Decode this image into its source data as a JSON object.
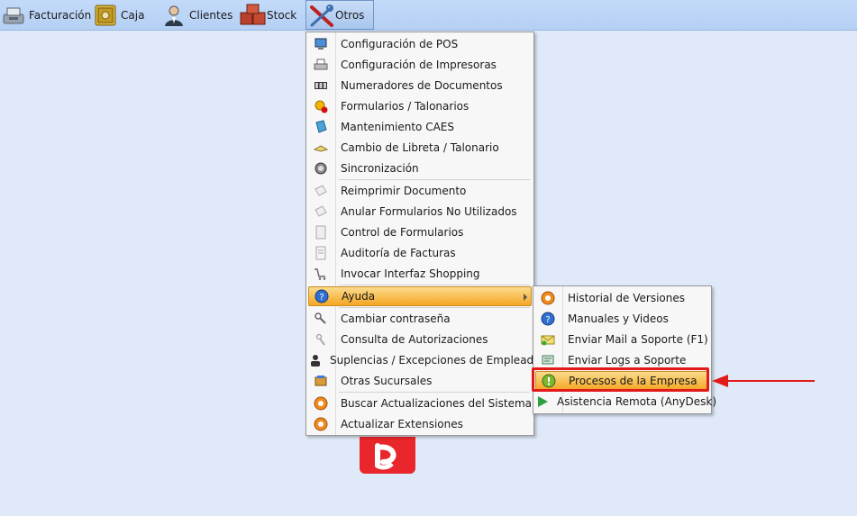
{
  "toolbar": {
    "items": [
      {
        "label": "Facturación",
        "icon": "cash-register-icon"
      },
      {
        "label": "Caja",
        "icon": "safe-icon"
      },
      {
        "label": "Clientes",
        "icon": "customers-icon"
      },
      {
        "label": "Stock",
        "icon": "boxes-icon"
      },
      {
        "label": "Otros",
        "icon": "tools-icon"
      }
    ]
  },
  "menu": {
    "items": [
      {
        "label": "Configuración de POS",
        "icon": "monitor-icon"
      },
      {
        "label": "Configuración de Impresoras",
        "icon": "printer-icon"
      },
      {
        "label": "Numeradores de Documentos",
        "icon": "counter-icon"
      },
      {
        "label": "Formularios / Talonarios",
        "icon": "gear-warning-icon"
      },
      {
        "label": "Mantenimiento CAES",
        "icon": "book-icon"
      },
      {
        "label": "Cambio de Libreta / Talonario",
        "icon": "notebook-icon"
      },
      {
        "label": "Sincronización",
        "icon": "sync-icon"
      },
      {
        "label": "Reimprimir Documento",
        "icon": "reprint-icon"
      },
      {
        "label": "Anular Formularios No Utilizados",
        "icon": "cancel-forms-icon"
      },
      {
        "label": "Control de Formularios",
        "icon": "forms-icon"
      },
      {
        "label": "Auditoría de Facturas",
        "icon": "audit-icon"
      },
      {
        "label": "Invocar Interfaz Shopping",
        "icon": "cart-icon"
      },
      {
        "label": "Ayuda",
        "icon": "help-icon"
      },
      {
        "label": "Cambiar contraseña",
        "icon": "keys-icon"
      },
      {
        "label": "Consulta de Autorizaciones",
        "icon": "authorization-icon"
      },
      {
        "label": "Suplencias / Excepciones de Empleados",
        "icon": "employee-icon"
      },
      {
        "label": "Otras Sucursales",
        "icon": "branches-icon"
      },
      {
        "label": "Buscar Actualizaciones del Sistema",
        "icon": "update-icon"
      },
      {
        "label": "Actualizar Extensiones",
        "icon": "update-extensions-icon"
      }
    ]
  },
  "submenu": {
    "items": [
      {
        "label": "Historial de Versiones",
        "icon": "history-icon"
      },
      {
        "label": "Manuales y Videos",
        "icon": "help-icon"
      },
      {
        "label": "Enviar Mail a Soporte (F1)",
        "icon": "mail-icon"
      },
      {
        "label": "Enviar Logs a Soporte",
        "icon": "logs-icon"
      },
      {
        "label": "Procesos de la Empresa",
        "icon": "process-icon"
      },
      {
        "label": "Asistencia Remota (AnyDesk)",
        "icon": "play-icon"
      }
    ]
  },
  "colors": {
    "highlight": "#f5a623",
    "annotation": "#e21a1a",
    "background": "#dfe9f8"
  }
}
